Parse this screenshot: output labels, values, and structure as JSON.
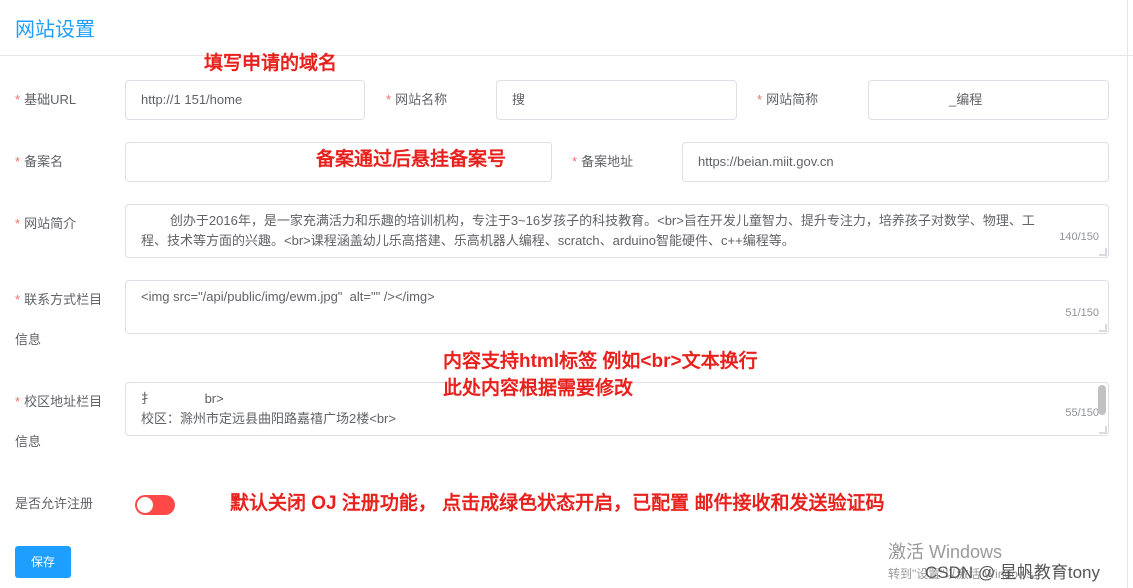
{
  "page": {
    "title": "网站设置"
  },
  "form": {
    "base_url": {
      "label": "基础URL",
      "value": "http://1                151/home"
    },
    "site_name": {
      "label": "网站名称",
      "value": "搜"
    },
    "site_short": {
      "label": "网站简称",
      "value": "_编程"
    },
    "icp_name": {
      "label": "备案名",
      "value": ""
    },
    "icp_url": {
      "label": "备案地址",
      "value": "https://beian.miit.gov.cn"
    },
    "intro": {
      "label": "网站简介",
      "value": "        创办于2016年，是一家充满活力和乐趣的培训机构，专注于3~16岁孩子的科技教育。<br>旨在开发儿童智力、提升专注力，培养孩子对数学、物理、工程、技术等方面的兴趣。<br>课程涵盖幼儿乐高搭建、乐高机器人编程、scratch、arduino智能硬件、c++编程等。",
      "counter": "140/150"
    },
    "contact": {
      "label_line1": "联系方式栏目",
      "label_line2": "信息",
      "value": "<img src=\"/api/public/img/ewm.jpg\"  alt=\"\" /></img>",
      "counter": "51/150"
    },
    "campus": {
      "label_line1": "校区地址栏目",
      "label_line2": "信息",
      "value": "扌              br>\n校区：滁州市定远县曲阳路嘉禧广场2楼<br>",
      "counter": "55/150"
    },
    "register": {
      "label": "是否允许注册",
      "enabled": false
    },
    "save_label": "保存"
  },
  "annotations": {
    "domain_hint": "填写申请的域名",
    "icp_hint": "备案通过后悬挂备案号",
    "html_hint_1": "内容支持html标签 例如<br>文本换行",
    "html_hint_2": "此处内容根据需要修改",
    "register_hint": "默认关闭 OJ 注册功能， 点击成绿色状态开启，已配置 邮件接收和发送验证码"
  },
  "watermark": {
    "activate": "激活 Windows",
    "activate_sub": "转到\"设置\"以激活 Windows。",
    "csdn": "CSDN @ 星帆教育tony"
  },
  "colors": {
    "accent": "#1e9fff",
    "required": "#f56c6c",
    "annotation": "#e8211d",
    "switch_off": "#ff4949"
  }
}
